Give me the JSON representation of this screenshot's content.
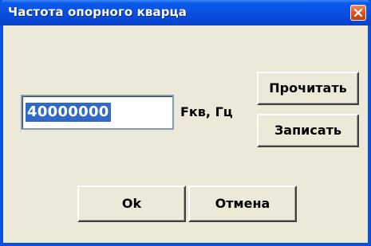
{
  "window": {
    "title": "Частота опорного кварца",
    "close_icon": "close-icon",
    "accent_color": "#0a4ee0",
    "close_color": "#e0541f"
  },
  "frequency": {
    "value": "40000000",
    "unit_label": "Fкв, Гц"
  },
  "buttons": {
    "read_label": "Прочитать",
    "write_label": "Записать",
    "ok_label": "Ok",
    "cancel_label": "Отмена"
  }
}
